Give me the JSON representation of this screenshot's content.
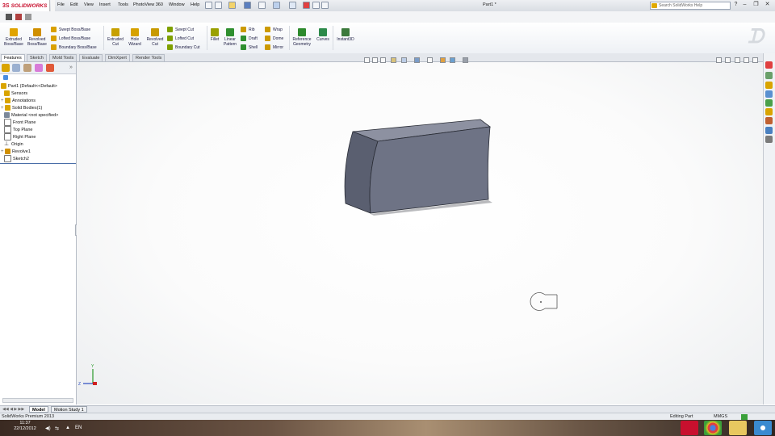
{
  "app": {
    "logo_ds": "3S",
    "logo_text": "SOLIDWORKS",
    "document_title": "Part1 *",
    "menu": [
      "File",
      "Edit",
      "View",
      "Insert",
      "Tools",
      "PhotoView 360",
      "Window",
      "Help"
    ],
    "search_placeholder": "Search SolidWorks Help"
  },
  "command_manager": {
    "big_buttons": [
      {
        "id": "extruded-boss",
        "label": "Extruded\nBoss/Base",
        "color": "#e0a300"
      },
      {
        "id": "revolved-boss",
        "label": "Revolved\nBoss/Base",
        "color": "#d08f00"
      },
      {
        "id": "extruded-cut",
        "label": "Extruded\nCut",
        "color": "#c7a000"
      },
      {
        "id": "hole-wizard",
        "label": "Hole\nWizard",
        "color": "#d6a100"
      },
      {
        "id": "revolved-cut",
        "label": "Revolved\nCut",
        "color": "#c89a00"
      },
      {
        "id": "fillet",
        "label": "Fillet",
        "color": "#9aa000"
      },
      {
        "id": "linear-pattern",
        "label": "Linear\nPattern",
        "color": "#2f8f2f"
      },
      {
        "id": "reference-geometry",
        "label": "Reference\nGeometry",
        "color": "#2d8a2d"
      },
      {
        "id": "curves",
        "label": "Curves",
        "color": "#2d8a4a"
      },
      {
        "id": "instant3d",
        "label": "Instant3D",
        "color": "#3c7a3c"
      }
    ],
    "small_buttons": [
      {
        "id": "swept-boss",
        "label": "Swept Boss/Base",
        "color": "#d9a000"
      },
      {
        "id": "lofted-boss",
        "label": "Lofted Boss/Base",
        "color": "#d9a000"
      },
      {
        "id": "boundary-boss",
        "label": "Boundary Boss/Base",
        "color": "#d9a000"
      },
      {
        "id": "swept-cut",
        "label": "Swept Cut",
        "color": "#7fa000"
      },
      {
        "id": "lofted-cut",
        "label": "Lofted Cut",
        "color": "#7fa000"
      },
      {
        "id": "boundary-cut",
        "label": "Boundary Cut",
        "color": "#7fa000"
      },
      {
        "id": "rib",
        "label": "Rib",
        "color": "#cc9a00"
      },
      {
        "id": "draft",
        "label": "Draft",
        "color": "#2f8f2f"
      },
      {
        "id": "shell",
        "label": "Shell",
        "color": "#2f8f2f"
      },
      {
        "id": "wrap",
        "label": "Wrap",
        "color": "#cc9a00"
      },
      {
        "id": "dome",
        "label": "Dome",
        "color": "#cc9a00"
      },
      {
        "id": "mirror",
        "label": "Mirror",
        "color": "#cc9a00"
      }
    ]
  },
  "tabs": [
    "Features",
    "Sketch",
    "Mold Tools",
    "Evaluate",
    "DimXpert",
    "Render Tools"
  ],
  "feature_tree": [
    {
      "label": "Part1  (Default<<Default>",
      "expander": ""
    },
    {
      "label": "Sensors",
      "expander": ""
    },
    {
      "label": "Annotations",
      "expander": "+"
    },
    {
      "label": "Solid Bodies(1)",
      "expander": "+"
    },
    {
      "label": "Material <not specified>",
      "expander": ""
    },
    {
      "label": "Front Plane",
      "expander": ""
    },
    {
      "label": "Top Plane",
      "expander": ""
    },
    {
      "label": "Right Plane",
      "expander": ""
    },
    {
      "label": "Origin",
      "expander": ""
    },
    {
      "label": "Revolve1",
      "expander": "+"
    },
    {
      "label": "Sketch2",
      "expander": ""
    }
  ],
  "bottom_tabs": [
    "Model",
    "Motion Study 1"
  ],
  "status": {
    "product": "SolidWorks Premium 2013",
    "mode": "Editing Part",
    "units": "MMGS"
  },
  "taskbar": {
    "time": "11:37",
    "date": "22/12/2012",
    "lang": "EN"
  },
  "colors": {
    "accent": "#c8102e",
    "model_front": "#6e7385",
    "model_side": "#5a5f70",
    "model_top": "#8d91a1"
  }
}
